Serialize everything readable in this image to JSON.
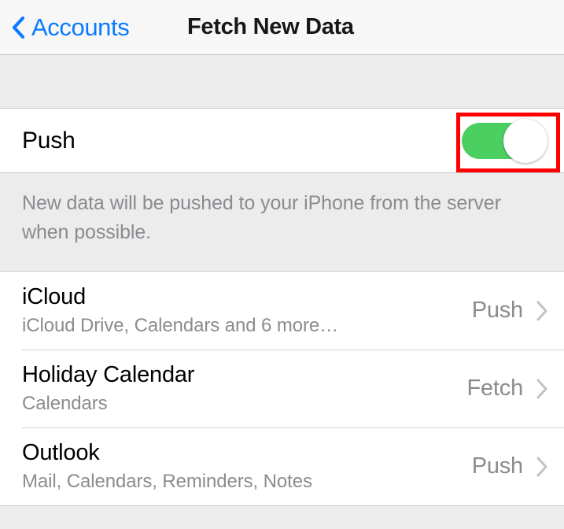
{
  "navbar": {
    "back_label": "Accounts",
    "back_icon": "chevron-left-icon",
    "title": "Fetch New Data",
    "accent_color": "#0a7bff"
  },
  "push_section": {
    "label": "Push",
    "toggle": {
      "state": "on",
      "on_color": "#4ccf61",
      "knob_color": "#ffffff"
    },
    "footer_note": "New data will be pushed to your iPhone from the server when possible."
  },
  "annotation": {
    "type": "highlight-rectangle",
    "color": "#ff0000",
    "target": "push-toggle"
  },
  "accounts": [
    {
      "title": "iCloud",
      "subtitle": "iCloud Drive, Calendars and 6 more…",
      "value": "Push",
      "disclosure_icon": "chevron-right-icon"
    },
    {
      "title": "Holiday Calendar",
      "subtitle": "Calendars",
      "value": "Fetch",
      "disclosure_icon": "chevron-right-icon"
    },
    {
      "title": "Outlook",
      "subtitle": "Mail, Calendars, Reminders, Notes",
      "value": "Push",
      "disclosure_icon": "chevron-right-icon"
    }
  ]
}
